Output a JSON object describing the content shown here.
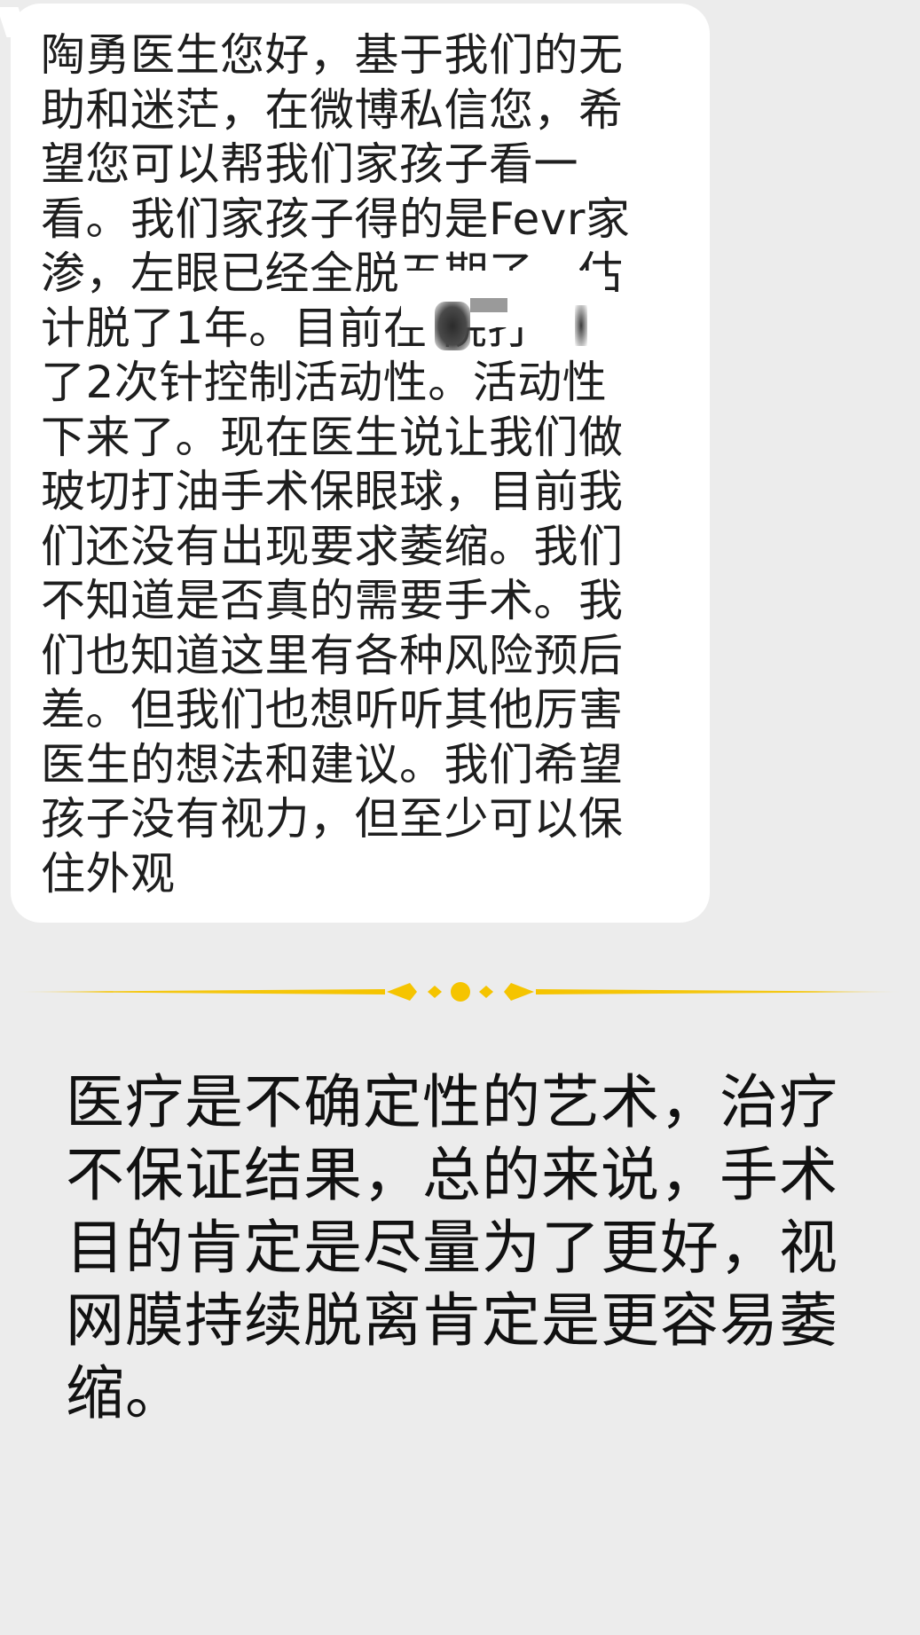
{
  "message": {
    "lines": [
      "陶勇医生您好，基于我们的无",
      "助和迷茫，在微博私信您，希",
      "望您可以帮我们家孩子看一",
      "看。我们家孩子得的是Fevr家",
      "渗，左眼已经全脱五期了，估",
      "计脱了1年。目前在        院打",
      "了2次针控制活动性。活动性",
      "下来了。现在医生说让我们做",
      "玻切打油手术保眼球，目前我",
      "们还没有出现要求萎缩。我们",
      "不知道是否真的需要手术。我",
      "们也知道这里有各种风险预后",
      "差。但我们也想听听其他厉害",
      "医生的想法和建议。我们希望",
      "孩子没有视力，但至少可以保",
      "住外观"
    ]
  },
  "divider": {
    "color": "#f5c400",
    "icon": "ornamental-divider-icon"
  },
  "reply": {
    "lines": [
      "医疗是不确定性的艺术，治疗",
      "不保证结果，总的来说，手术",
      "目的肯定是尽量为了更好，视",
      "网膜持续脱离肯定是更容易萎",
      "缩。"
    ]
  }
}
